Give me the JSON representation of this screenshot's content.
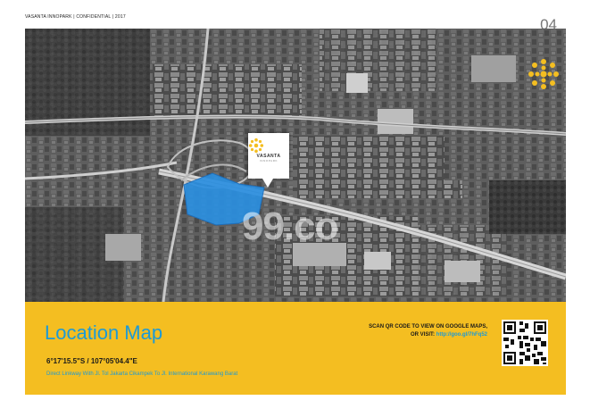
{
  "header": {
    "meta": "VASANTA INNOPARK | CONFIDENTIAL | 2017",
    "page_number": "04"
  },
  "map": {
    "badge_brand": "VASANTA",
    "badge_sub": "INNOPARK",
    "watermark": "99.co",
    "highlight_color": "#2b8fe0"
  },
  "panel": {
    "title": "Location Map",
    "coordinates": "6°17'15.5\"S / 107°05'04.4\"E",
    "description": "Direct Linkway With Jl. Tol Jakarta Cikampek To Jl. International Karawang Barat",
    "scan_text": "SCAN QR CODE TO VIEW ON GOOGLE MAPS,",
    "visit_text": "OR VISIT: ",
    "visit_url": "http://goo.gl/7hFq52",
    "background_color": "#f4be21",
    "accent_color": "#1c9ad6"
  }
}
